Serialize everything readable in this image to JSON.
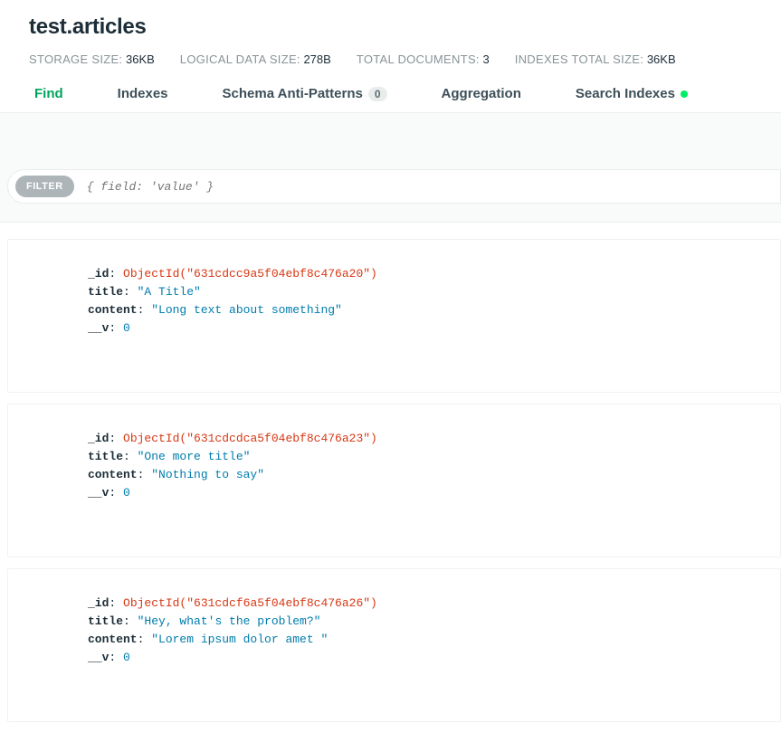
{
  "title": "test.articles",
  "stats": {
    "storage_label": "STORAGE SIZE:",
    "storage_value": "36KB",
    "logical_label": "LOGICAL DATA SIZE:",
    "logical_value": "278B",
    "docs_label": "TOTAL DOCUMENTS:",
    "docs_value": "3",
    "indexes_label": "INDEXES TOTAL SIZE:",
    "indexes_value": "36KB"
  },
  "tabs": {
    "find": "Find",
    "indexes": "Indexes",
    "schema": "Schema Anti-Patterns",
    "schema_count": "0",
    "aggregation": "Aggregation",
    "search": "Search Indexes"
  },
  "filter": {
    "pill": "FILTER",
    "placeholder": "{ field: 'value' }"
  },
  "documents": [
    {
      "_id": "ObjectId(\"631cdcc9a5f04ebf8c476a20\")",
      "title": "\"A Title\"",
      "content": "\"Long text about something\"",
      "__v": "0"
    },
    {
      "_id": "ObjectId(\"631cdcdca5f04ebf8c476a23\")",
      "title": "\"One more title\"",
      "content": "\"Nothing to say\"",
      "__v": "0"
    },
    {
      "_id": "ObjectId(\"631cdcf6a5f04ebf8c476a26\")",
      "title": "\"Hey, what's the problem?\"",
      "content": "\"Lorem ipsum dolor amet \"",
      "__v": "0"
    }
  ]
}
